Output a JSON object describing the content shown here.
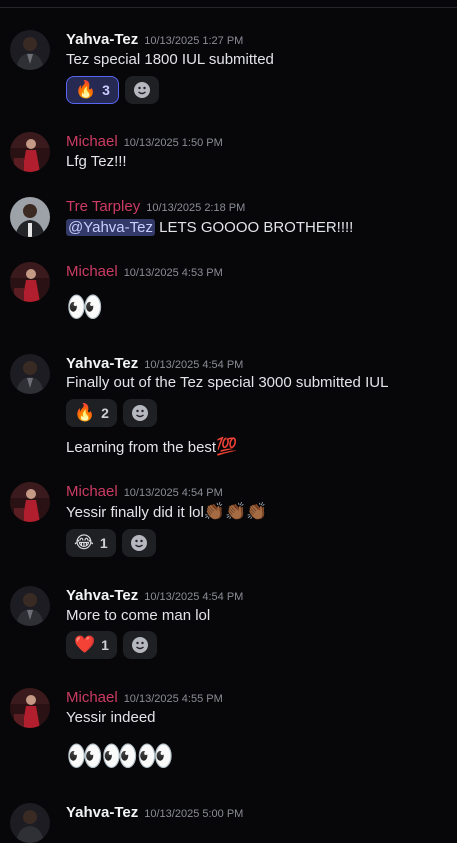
{
  "messages": [
    {
      "author": "Yahva-Tez",
      "time": "10/13/2025 1:27 PM",
      "text": "Tez special 1800 IUL submitted",
      "reaction": {
        "emoji": "🔥",
        "count": "3"
      }
    },
    {
      "author": "Michael",
      "time": "10/13/2025 1:50 PM",
      "text": "Lfg Tez!!!"
    },
    {
      "author": "Tre Tarpley",
      "time": "10/13/2025 2:18 PM",
      "mention": "@Yahva-Tez",
      "text": " LETS GOOOO BROTHER!!!!"
    },
    {
      "author": "Michael",
      "time": "10/13/2025 4:53 PM",
      "emoji": "👀"
    },
    {
      "author": "Yahva-Tez",
      "time": "10/13/2025 4:54 PM",
      "text": "Finally out of the Tez special 3000 submitted IUL",
      "reaction": {
        "emoji": "🔥",
        "count": "2"
      },
      "followup": "Learning from the best",
      "followup_emoji": "💯"
    },
    {
      "author": "Michael",
      "time": "10/13/2025 4:54 PM",
      "text": "Yessir finally did it lol",
      "text_emoji": "👏🏾👏🏾👏🏾",
      "reaction": {
        "emoji": "😂",
        "count": "1"
      }
    },
    {
      "author": "Yahva-Tez",
      "time": "10/13/2025 4:54 PM",
      "text": "More to come man lol",
      "reaction": {
        "emoji": "❤️",
        "count": "1"
      }
    },
    {
      "author": "Michael",
      "time": "10/13/2025 4:55 PM",
      "text": "Yessir indeed",
      "emoji": "👀👀👀"
    },
    {
      "author": "Yahva-Tez",
      "time": "10/13/2025 5:00 PM"
    }
  ],
  "colors": {
    "role_pink": "#cc3b63",
    "background": "#070709",
    "reaction_active_border": "#5865f2"
  },
  "icons": {
    "add_reaction": "smiley-icon"
  }
}
